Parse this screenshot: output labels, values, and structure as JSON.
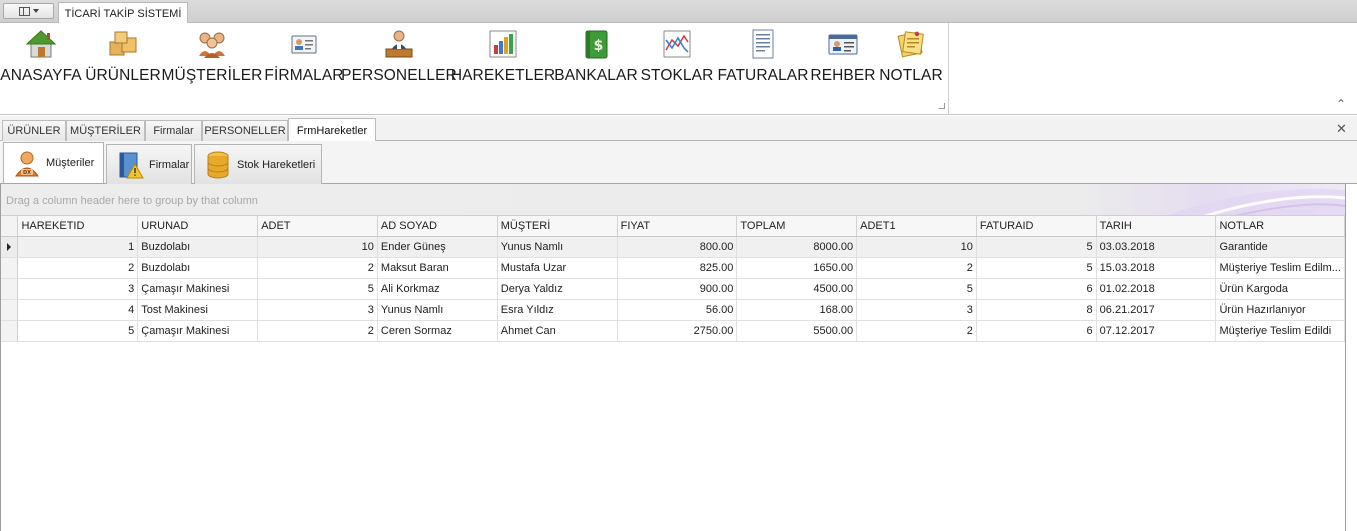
{
  "title_strip": {
    "page_tab": "TİCARİ TAKİP SİSTEMİ"
  },
  "ribbon": {
    "buttons": [
      {
        "label": "ANASAYFA",
        "icon": "house-icon"
      },
      {
        "label": "ÜRÜNLER",
        "icon": "boxes-icon"
      },
      {
        "label": "MÜŞTERİLER",
        "icon": "people-icon"
      },
      {
        "label": "FİRMALAR",
        "icon": "contact-card-icon"
      },
      {
        "label": "PERSONELLER",
        "icon": "worker-desk-icon"
      },
      {
        "label": "HAREKETLER",
        "icon": "bar-chart-icon"
      },
      {
        "label": "BANKALAR",
        "icon": "money-book-icon"
      },
      {
        "label": "STOKLAR",
        "icon": "line-chart-icon"
      },
      {
        "label": "FATURALAR",
        "icon": "invoice-icon"
      },
      {
        "label": "REHBER",
        "icon": "address-card-icon"
      },
      {
        "label": "NOTLAR",
        "icon": "notes-icon"
      }
    ]
  },
  "doc_tabs": [
    {
      "label": "ÜRÜNLER",
      "active": false
    },
    {
      "label": "MÜŞTERİLER",
      "active": false
    },
    {
      "label": "Firmalar",
      "active": false
    },
    {
      "label": "PERSONELLER",
      "active": false
    },
    {
      "label": "FrmHareketler",
      "active": true
    }
  ],
  "inner_tabs": [
    {
      "label": "Müşteriler",
      "icon": "customer-icon",
      "active": true
    },
    {
      "label": "Firmalar",
      "icon": "company-warning-icon",
      "active": false
    },
    {
      "label": "Stok Hareketleri",
      "icon": "database-icon",
      "active": false
    }
  ],
  "grid": {
    "group_hint": "Drag a column header here to group by that column",
    "columns": [
      "HAREKETID",
      "URUNAD",
      "ADET",
      "AD SOYAD",
      "MÜŞTERİ",
      "FIYAT",
      "TOPLAM",
      "ADET1",
      "FATURAID",
      "TARIH",
      "NOTLAR"
    ],
    "rows": [
      [
        "1",
        "Buzdolabı",
        "10",
        "Ender Güneş",
        "Yunus Namlı",
        "800.00",
        "8000.00",
        "10",
        "5",
        "03.03.2018",
        "Garantide"
      ],
      [
        "2",
        "Buzdolabı",
        "2",
        "Maksut Baran",
        "Mustafa Uzar",
        "825.00",
        "1650.00",
        "2",
        "5",
        "15.03.2018",
        "Müşteriye Teslim Edilm..."
      ],
      [
        "3",
        "Çamaşır Makinesi",
        "5",
        "Ali  Korkmaz",
        "Derya  Yaldız",
        "900.00",
        "4500.00",
        "5",
        "6",
        "01.02.2018",
        "Ürün Kargoda"
      ],
      [
        "4",
        "Tost Makinesi",
        "3",
        "Yunus Namlı",
        "Esra Yıldız",
        "56.00",
        "168.00",
        "3",
        "8",
        "06.21.2017",
        "Ürün Hazırlanıyor"
      ],
      [
        "5",
        "Çamaşır Makinesi",
        "2",
        "Ceren Sormaz",
        "Ahmet  Can",
        "2750.00",
        "5500.00",
        "2",
        "6",
        "07.12.2017",
        "Müşteriye Teslim Edildi"
      ]
    ]
  }
}
